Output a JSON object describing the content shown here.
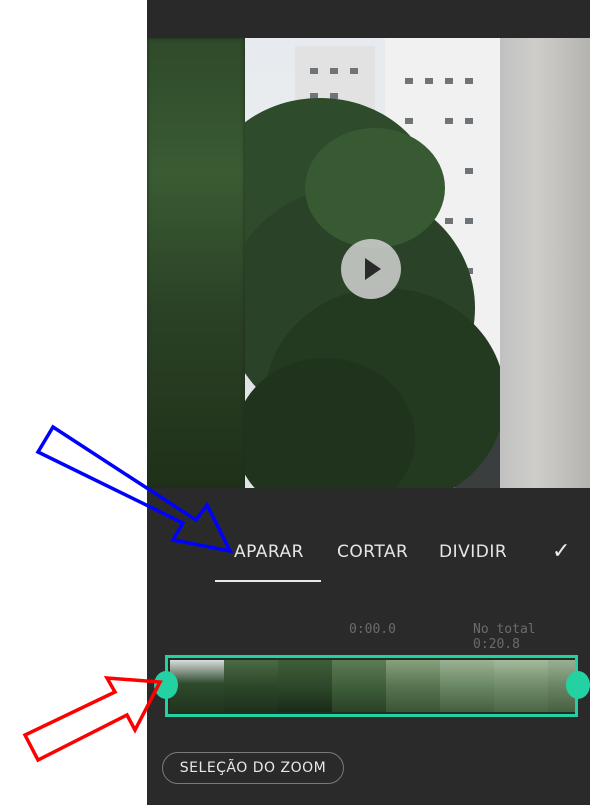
{
  "tabs": [
    {
      "label": "APARAR",
      "active": true
    },
    {
      "label": "CORTAR",
      "active": false
    },
    {
      "label": "DIVIDIR",
      "active": false
    }
  ],
  "confirm_icon": "check-icon",
  "timeline": {
    "start_time": "0:00.0",
    "total_label": "No total 0:20.8"
  },
  "zoom_button": {
    "label": "SELEÇÃO DO ZOOM"
  },
  "colors": {
    "accent": "#23d1a2",
    "panel": "#2a2a2a",
    "annotation_blue": "#0000ff",
    "annotation_red": "#ff0000"
  }
}
